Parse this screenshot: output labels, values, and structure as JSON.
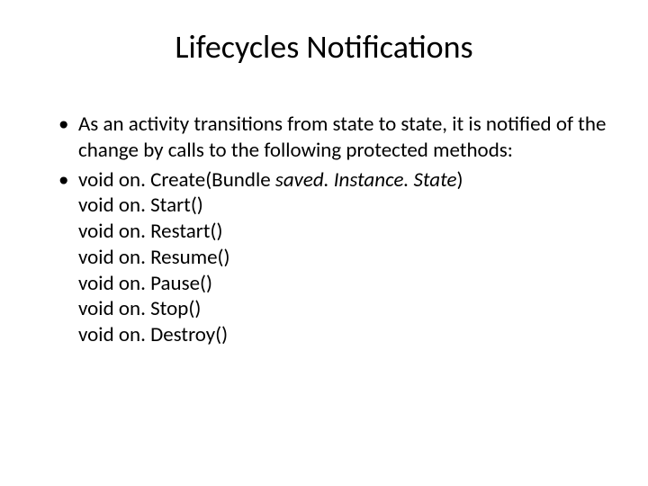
{
  "title": "Lifecycles Notifications",
  "bullets": [
    {
      "text": "As an activity transitions from state to state, it is notified of the change by calls to the following protected methods:"
    },
    {
      "prefix": "void on. Create(Bundle ",
      "italic": "saved. Instance. State",
      "suffix": ") ",
      "sublines": [
        "void on. Start() ",
        "void on. Restart() ",
        "void on. Resume() ",
        "void on. Pause() ",
        "void on. Stop() ",
        "void on. Destroy()"
      ]
    }
  ]
}
